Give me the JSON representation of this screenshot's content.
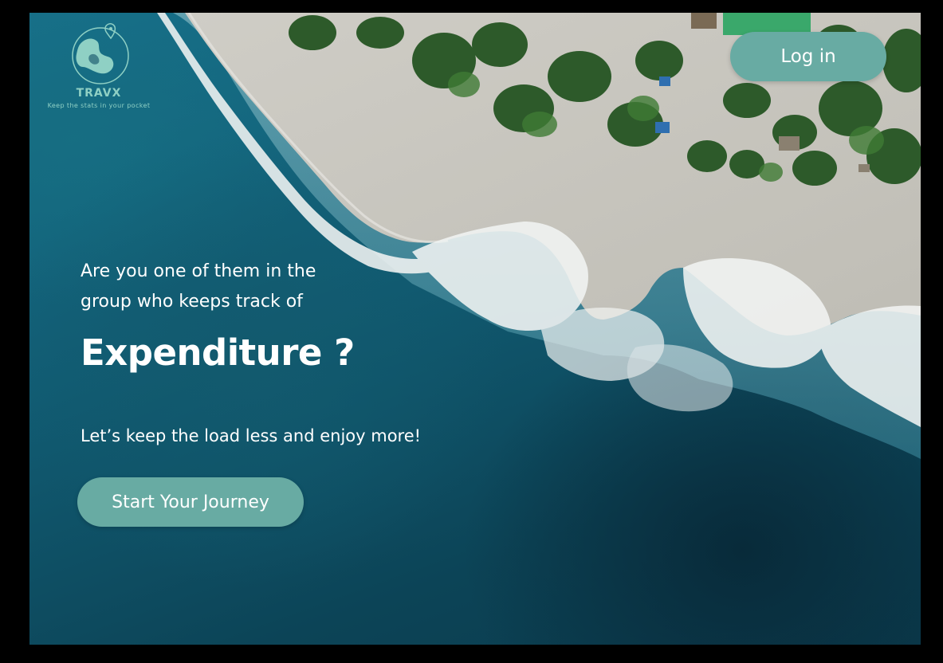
{
  "brand": {
    "name": "TRAVX",
    "tagline": "Keep the stats in your pocket",
    "logo_icon": "globe-map-pin-icon",
    "accent_color": "#68aba3",
    "logo_color": "#8fd0c4"
  },
  "header": {
    "login_label": "Log in"
  },
  "hero": {
    "intro_line1": "Are you one of them in the",
    "intro_line2": "group who keeps track of",
    "title": "Expenditure ?",
    "subtitle": "Let’s keep the load less and enjoy more!",
    "cta_label": "Start Your Journey"
  },
  "background": {
    "scene": "aerial-beach-photo"
  }
}
